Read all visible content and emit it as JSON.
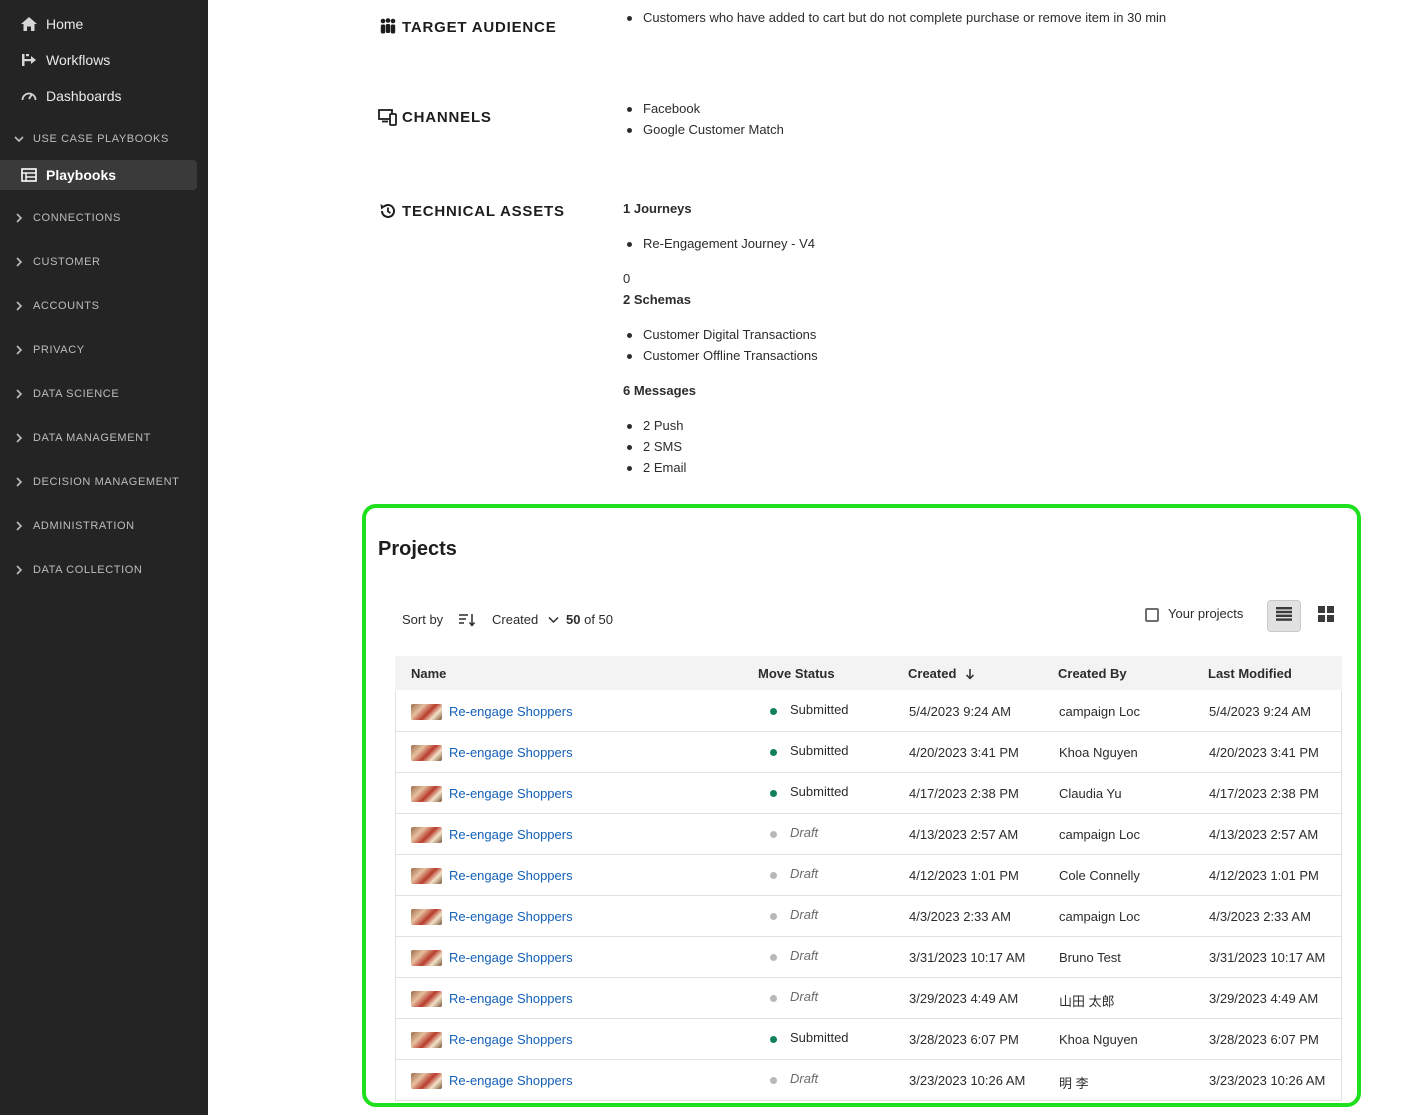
{
  "sidebar": {
    "top_items": [
      {
        "label": "Home",
        "icon": "home-icon"
      },
      {
        "label": "Workflows",
        "icon": "workflow-icon"
      },
      {
        "label": "Dashboards",
        "icon": "dashboard-gauge-icon"
      }
    ],
    "use_case_section": "USE CASE PLAYBOOKS",
    "active_item": {
      "label": "Playbooks",
      "icon": "playbook-icon"
    },
    "sections": [
      "CONNECTIONS",
      "CUSTOMER",
      "ACCOUNTS",
      "PRIVACY",
      "DATA SCIENCE",
      "DATA MANAGEMENT",
      "DECISION MANAGEMENT",
      "ADMINISTRATION",
      "DATA COLLECTION"
    ]
  },
  "details": {
    "target_audience": {
      "heading": "TARGET AUDIENCE",
      "items": [
        "Customers who have added to cart but do not complete purchase or remove item in 30 min"
      ]
    },
    "channels": {
      "heading": "CHANNELS",
      "items": [
        "Facebook",
        "Google Customer Match"
      ]
    },
    "technical_assets": {
      "heading": "TECHNICAL ASSETS",
      "journeys_title": "1 Journeys",
      "journeys": [
        "Re-Engagement Journey - V4"
      ],
      "zero": "0",
      "schemas_title": "2 Schemas",
      "schemas": [
        "Customer Digital Transactions",
        "Customer Offline Transactions"
      ],
      "messages_title": "6 Messages",
      "messages": [
        "2 Push",
        "2 SMS",
        "2 Email"
      ]
    }
  },
  "projects": {
    "title": "Projects",
    "sort_by_label": "Sort by",
    "sort_field": "Created",
    "count_bold": "50",
    "count_rest": "of 50",
    "your_projects_label": "Your projects",
    "columns": [
      "Name",
      "Move Status",
      "Created",
      "Created By",
      "Last Modified"
    ],
    "rows": [
      {
        "name": "Re-engage Shoppers",
        "status": "Submitted",
        "created": "5/4/2023 9:24 AM",
        "created_by": "campaign Loc",
        "last_modified": "5/4/2023 9:24 AM"
      },
      {
        "name": "Re-engage Shoppers",
        "status": "Submitted",
        "created": "4/20/2023 3:41 PM",
        "created_by": "Khoa Nguyen",
        "last_modified": "4/20/2023 3:41 PM"
      },
      {
        "name": "Re-engage Shoppers",
        "status": "Submitted",
        "created": "4/17/2023 2:38 PM",
        "created_by": "Claudia Yu",
        "last_modified": "4/17/2023 2:38 PM"
      },
      {
        "name": "Re-engage Shoppers",
        "status": "Draft",
        "created": "4/13/2023 2:57 AM",
        "created_by": "campaign Loc",
        "last_modified": "4/13/2023 2:57 AM"
      },
      {
        "name": "Re-engage Shoppers",
        "status": "Draft",
        "created": "4/12/2023 1:01 PM",
        "created_by": "Cole Connelly",
        "last_modified": "4/12/2023 1:01 PM"
      },
      {
        "name": "Re-engage Shoppers",
        "status": "Draft",
        "created": "4/3/2023 2:33 AM",
        "created_by": "campaign Loc",
        "last_modified": "4/3/2023 2:33 AM"
      },
      {
        "name": "Re-engage Shoppers",
        "status": "Draft",
        "created": "3/31/2023 10:17 AM",
        "created_by": "Bruno Test",
        "last_modified": "3/31/2023 10:17 AM"
      },
      {
        "name": "Re-engage Shoppers",
        "status": "Draft",
        "created": "3/29/2023 4:49 AM",
        "created_by": "山田 太郎",
        "last_modified": "3/29/2023 4:49 AM"
      },
      {
        "name": "Re-engage Shoppers",
        "status": "Submitted",
        "created": "3/28/2023 6:07 PM",
        "created_by": "Khoa Nguyen",
        "last_modified": "3/28/2023 6:07 PM"
      },
      {
        "name": "Re-engage Shoppers",
        "status": "Draft",
        "created": "3/23/2023 10:26 AM",
        "created_by": "明 李",
        "last_modified": "3/23/2023 10:26 AM"
      }
    ],
    "status_colors": {
      "Submitted": "#12805c",
      "Draft": "#b8b8b8"
    }
  },
  "colors": {
    "highlight_outline": "#1ee01e",
    "link": "#1360b8",
    "sidebar_bg": "#242424"
  }
}
